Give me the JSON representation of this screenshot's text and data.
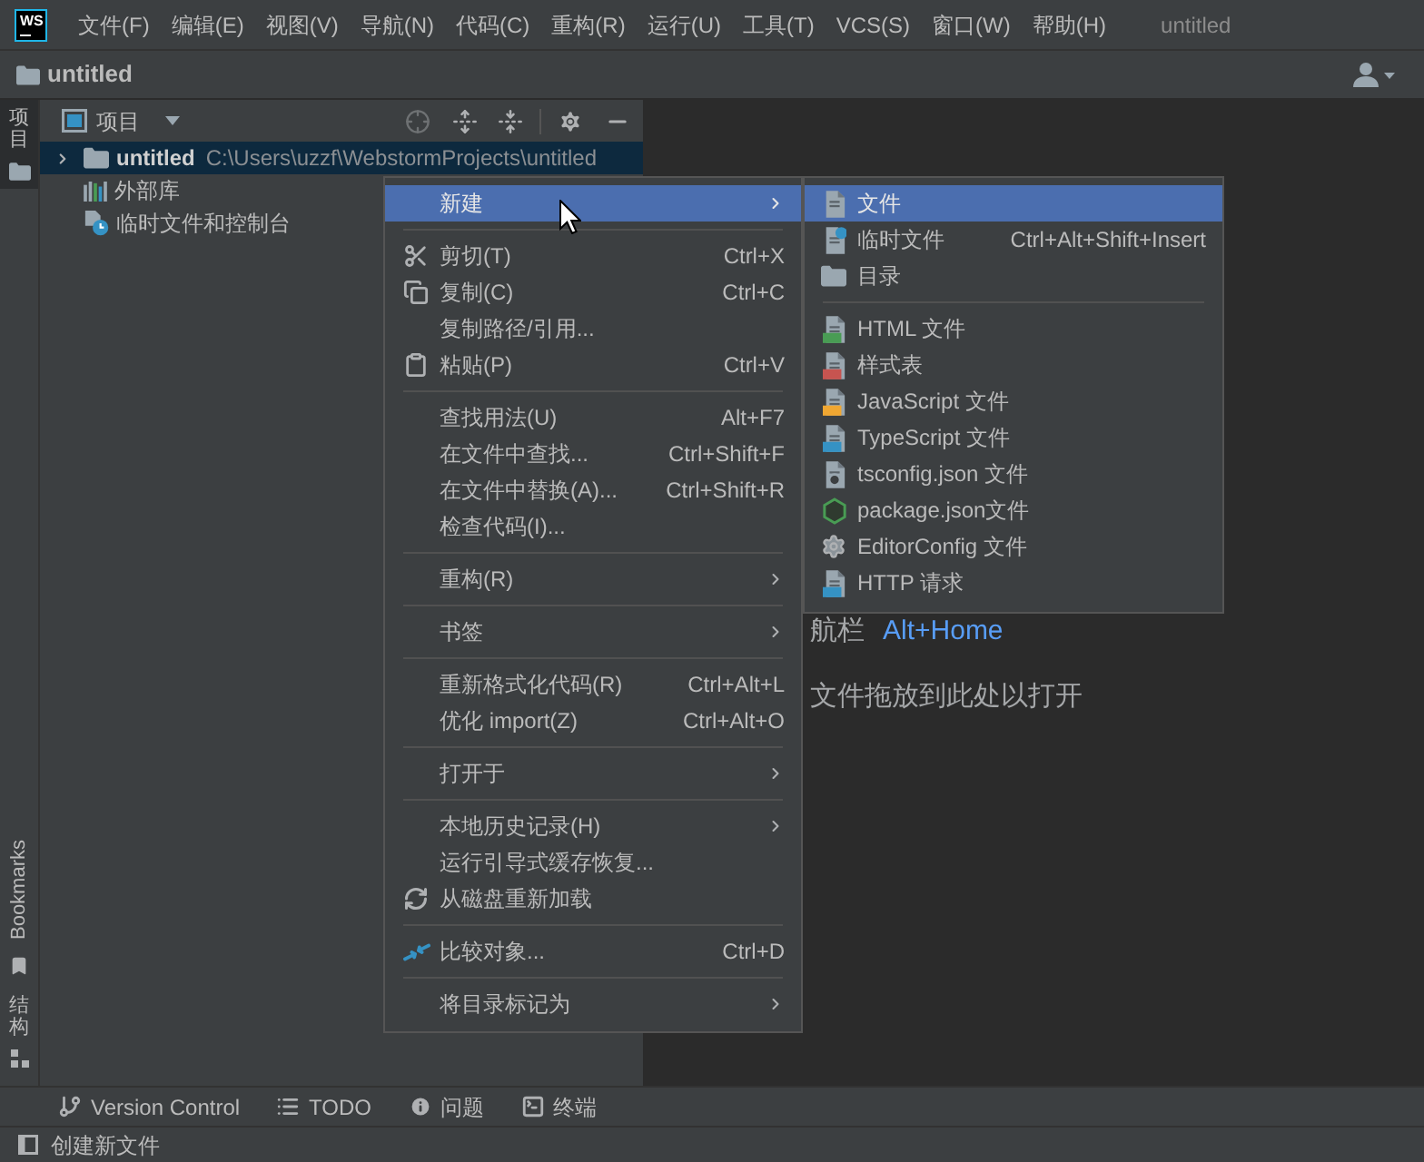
{
  "title_bar": {
    "logo": "WS",
    "menu": [
      "文件(F)",
      "编辑(E)",
      "视图(V)",
      "导航(N)",
      "代码(C)",
      "重构(R)",
      "运行(U)",
      "工具(T)",
      "VCS(S)",
      "窗口(W)",
      "帮助(H)"
    ],
    "title": "untitled"
  },
  "nav_bar": {
    "breadcrumb": "untitled"
  },
  "tool_strip": {
    "top": [
      {
        "label": "项目",
        "kind": "stacked",
        "selected": true
      }
    ],
    "bottom": [
      {
        "label": "Bookmarks",
        "kind": "rotated",
        "selected": false
      },
      {
        "label": "结构",
        "kind": "stacked",
        "selected": false
      }
    ]
  },
  "project_panel": {
    "title": "项目",
    "tree": [
      {
        "label": "untitled",
        "path": "C:\\Users\\uzzf\\WebstormProjects\\untitled",
        "kind": "root",
        "expanded": false,
        "selected": true
      },
      {
        "label": "外部库",
        "kind": "leaf",
        "selected": false
      },
      {
        "label": "临时文件和控制台",
        "kind": "leaf",
        "selected": false
      }
    ]
  },
  "editor": {
    "hints": [
      {
        "text": "航栏",
        "shortcut": "Alt+Home"
      },
      {
        "text": "文件拖放到此处以打开"
      }
    ]
  },
  "context_menu": {
    "groups": [
      {
        "items": [
          {
            "label": "新建",
            "selected": true,
            "submenu": true
          }
        ]
      },
      {
        "items": [
          {
            "label": "剪切(T)",
            "shortcut": "Ctrl+X",
            "selected": false,
            "submenu": false
          },
          {
            "label": "复制(C)",
            "shortcut": "Ctrl+C",
            "selected": false,
            "submenu": false
          },
          {
            "label": "复制路径/引用...",
            "selected": false,
            "submenu": false
          },
          {
            "label": "粘贴(P)",
            "shortcut": "Ctrl+V",
            "selected": false,
            "submenu": false
          }
        ]
      },
      {
        "items": [
          {
            "label": "查找用法(U)",
            "shortcut": "Alt+F7",
            "selected": false,
            "submenu": false
          },
          {
            "label": "在文件中查找...",
            "shortcut": "Ctrl+Shift+F",
            "selected": false,
            "submenu": false
          },
          {
            "label": "在文件中替换(A)...",
            "shortcut": "Ctrl+Shift+R",
            "selected": false,
            "submenu": false
          },
          {
            "label": "检查代码(I)...",
            "selected": false,
            "submenu": false
          }
        ]
      },
      {
        "items": [
          {
            "label": "重构(R)",
            "selected": false,
            "submenu": true
          }
        ]
      },
      {
        "items": [
          {
            "label": "书签",
            "selected": false,
            "submenu": true
          }
        ]
      },
      {
        "items": [
          {
            "label": "重新格式化代码(R)",
            "shortcut": "Ctrl+Alt+L",
            "selected": false,
            "submenu": false
          },
          {
            "label": "优化 import(Z)",
            "shortcut": "Ctrl+Alt+O",
            "selected": false,
            "submenu": false
          }
        ]
      },
      {
        "items": [
          {
            "label": "打开于",
            "selected": false,
            "submenu": true
          }
        ]
      },
      {
        "items": [
          {
            "label": "本地历史记录(H)",
            "selected": false,
            "submenu": true
          },
          {
            "label": "运行引导式缓存恢复...",
            "selected": false,
            "submenu": false
          },
          {
            "label": "从磁盘重新加载",
            "selected": false,
            "submenu": false
          }
        ]
      },
      {
        "items": [
          {
            "label": "比较对象...",
            "shortcut": "Ctrl+D",
            "selected": false,
            "submenu": false
          }
        ]
      },
      {
        "items": [
          {
            "label": "将目录标记为",
            "selected": false,
            "submenu": true
          }
        ]
      }
    ]
  },
  "new_submenu": {
    "groups": [
      {
        "items": [
          {
            "label": "文件",
            "selected": true
          },
          {
            "label": "临时文件",
            "shortcut": "Ctrl+Alt+Shift+Insert",
            "selected": false
          },
          {
            "label": "目录",
            "selected": false
          }
        ]
      },
      {
        "items": [
          {
            "label": "HTML 文件",
            "selected": false
          },
          {
            "label": "样式表",
            "selected": false
          },
          {
            "label": "JavaScript 文件",
            "selected": false
          },
          {
            "label": "TypeScript 文件",
            "selected": false
          },
          {
            "label": "tsconfig.json 文件",
            "selected": false
          },
          {
            "label": "package.json文件",
            "selected": false
          },
          {
            "label": "EditorConfig 文件",
            "selected": false
          },
          {
            "label": "HTTP 请求",
            "selected": false
          }
        ]
      }
    ]
  },
  "tool_window_bar": {
    "tabs": [
      "Version Control",
      "TODO",
      "问题",
      "终端"
    ]
  },
  "status_bar": {
    "message": "创建新文件"
  }
}
